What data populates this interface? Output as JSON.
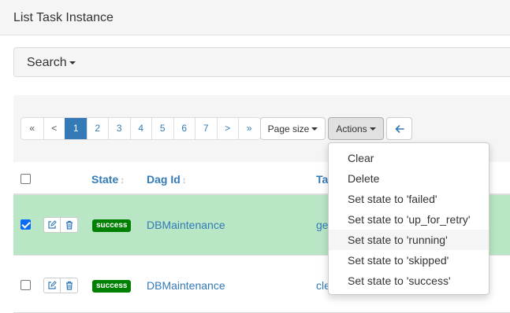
{
  "page": {
    "title": "List Task Instance"
  },
  "search": {
    "label": "Search"
  },
  "pagination": {
    "items": [
      "«",
      "<",
      "1",
      "2",
      "3",
      "4",
      "5",
      "6",
      "7",
      ">",
      "»"
    ],
    "active": "1"
  },
  "toolbar": {
    "page_size_label": "Page size",
    "actions_label": "Actions",
    "back_icon": "arrow-left-icon"
  },
  "table": {
    "headers": {
      "state": "State",
      "dag_id": "Dag Id",
      "task_partial": "Ta"
    },
    "rows": [
      {
        "checked": true,
        "state": "success",
        "dag_id": "DBMaintenance",
        "task_partial": "ge"
      },
      {
        "checked": false,
        "state": "success",
        "dag_id": "DBMaintenance",
        "task_partial": "cle"
      }
    ]
  },
  "actions_menu": {
    "items": [
      "Clear",
      "Delete",
      "Set state to 'failed'",
      "Set state to 'up_for_retry'",
      "Set state to 'running'",
      "Set state to 'skipped'",
      "Set state to 'success'"
    ],
    "highlighted": "Set state to 'running'"
  },
  "colors": {
    "link": "#337ab7",
    "success_badge": "#008000",
    "selected_row": "#b9e7c5",
    "active_page": "#337ab7"
  }
}
